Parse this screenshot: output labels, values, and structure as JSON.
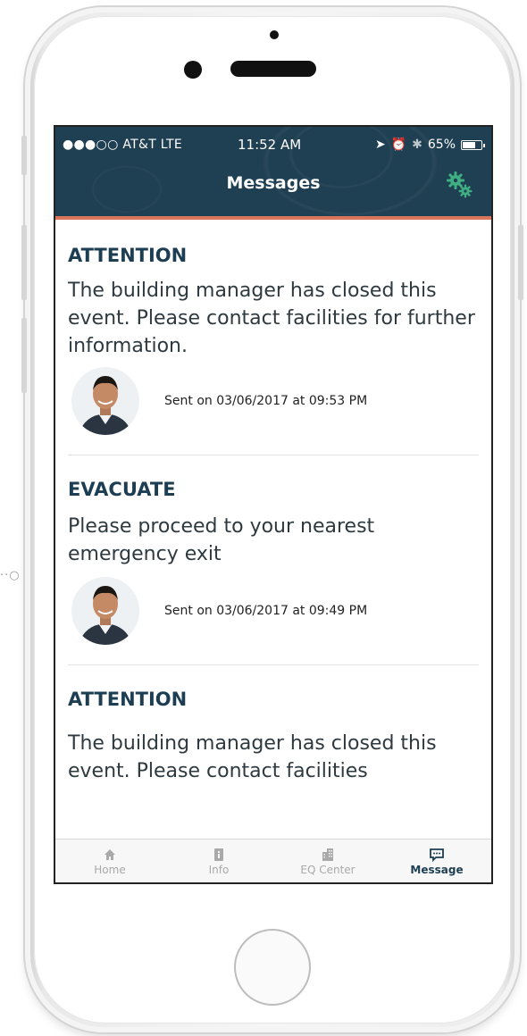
{
  "status_bar": {
    "carrier": "●●●○○ AT&T  LTE",
    "time": "11:52 AM",
    "battery": "65%"
  },
  "nav": {
    "title": "Messages",
    "settings_icon": "gears-icon"
  },
  "messages": [
    {
      "title": "ATTENTION",
      "body": "The building manager has closed this event. Please contact facilities for further information.",
      "sent": "Sent on 03/06/2017 at 09:53 PM"
    },
    {
      "title": "EVACUATE",
      "body": "Please proceed to your nearest emergency exit",
      "sent": "Sent on 03/06/2017 at 09:49 PM"
    },
    {
      "title": "ATTENTION",
      "body": "The building manager has closed this event. Please contact facilities"
    }
  ],
  "tabs": [
    {
      "label": "Home",
      "icon": "home-icon"
    },
    {
      "label": "Info",
      "icon": "info-icon"
    },
    {
      "label": "EQ Center",
      "icon": "building-icon"
    },
    {
      "label": "Message",
      "icon": "message-icon",
      "active": true
    }
  ],
  "colors": {
    "header_bg": "#1f3f52",
    "accent_line": "#d9755a",
    "title_text": "#1d3e52",
    "gear": "#3fae82"
  }
}
